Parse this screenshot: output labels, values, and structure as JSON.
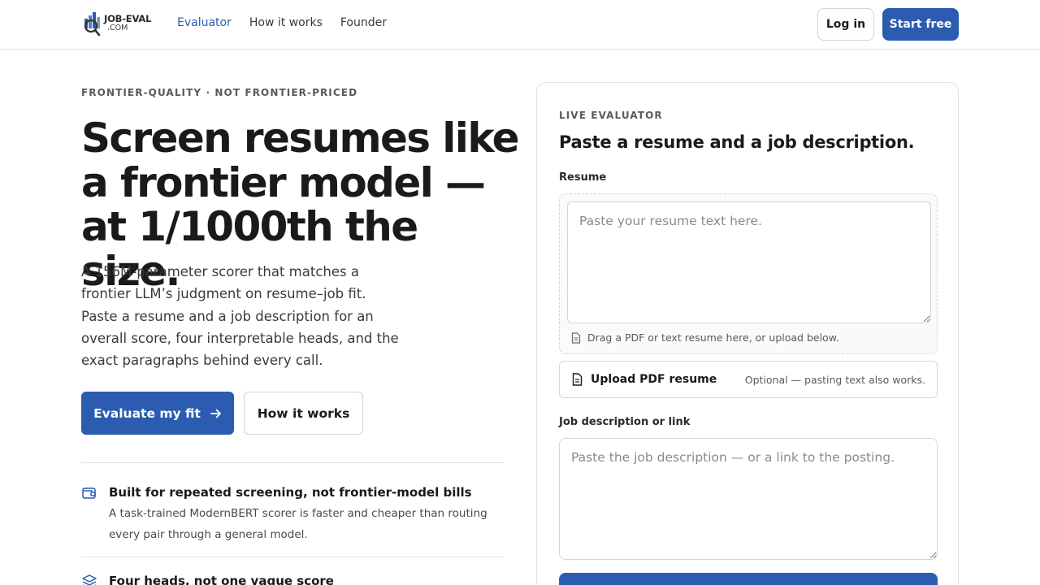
{
  "header": {
    "logo": {
      "main": "JOB-EVAL",
      "sub": ".COM"
    },
    "nav": [
      {
        "label": "Evaluator",
        "active": true
      },
      {
        "label": "How it works",
        "active": false
      },
      {
        "label": "Founder",
        "active": false
      }
    ],
    "login_label": "Log in",
    "start_label": "Start free"
  },
  "hero": {
    "eyebrow": "FRONTIER-QUALITY · NOT FRONTIER-PRICED",
    "title": "Screen resumes like a frontier model — at 1/1000th the size.",
    "description": "A 156M-parameter scorer that matches a frontier LLM’s judgment on resume–job fit. Paste a resume and a job description for an overall score, four interpretable heads, and the exact paragraphs behind every call.",
    "primary_cta": "Evaluate my fit",
    "secondary_cta": "How it works"
  },
  "features": [
    {
      "icon": "wallet-icon",
      "title": "Built for repeated screening, not frontier-model bills",
      "body": "A task-trained ModernBERT scorer is faster and cheaper than routing every pair through a general model."
    },
    {
      "icon": "layers-icon",
      "title": "Four heads, not one vague score",
      "body": ""
    }
  ],
  "evaluator": {
    "eyebrow": "LIVE EVALUATOR",
    "title": "Paste a resume and a job description.",
    "resume_label": "Resume",
    "resume_placeholder": "Paste your resume text here.",
    "drop_hint": "Drag a PDF or text resume here, or upload below.",
    "upload_label": "Upload PDF resume",
    "upload_note": "Optional — pasting text also works.",
    "job_label": "Job description or link",
    "job_placeholder": "Paste the job description — or a link to the posting."
  },
  "colors": {
    "accent": "#2b5cb0",
    "text": "#1a1a1a",
    "muted": "#5a5a5a",
    "border": "#e3e3e3"
  }
}
